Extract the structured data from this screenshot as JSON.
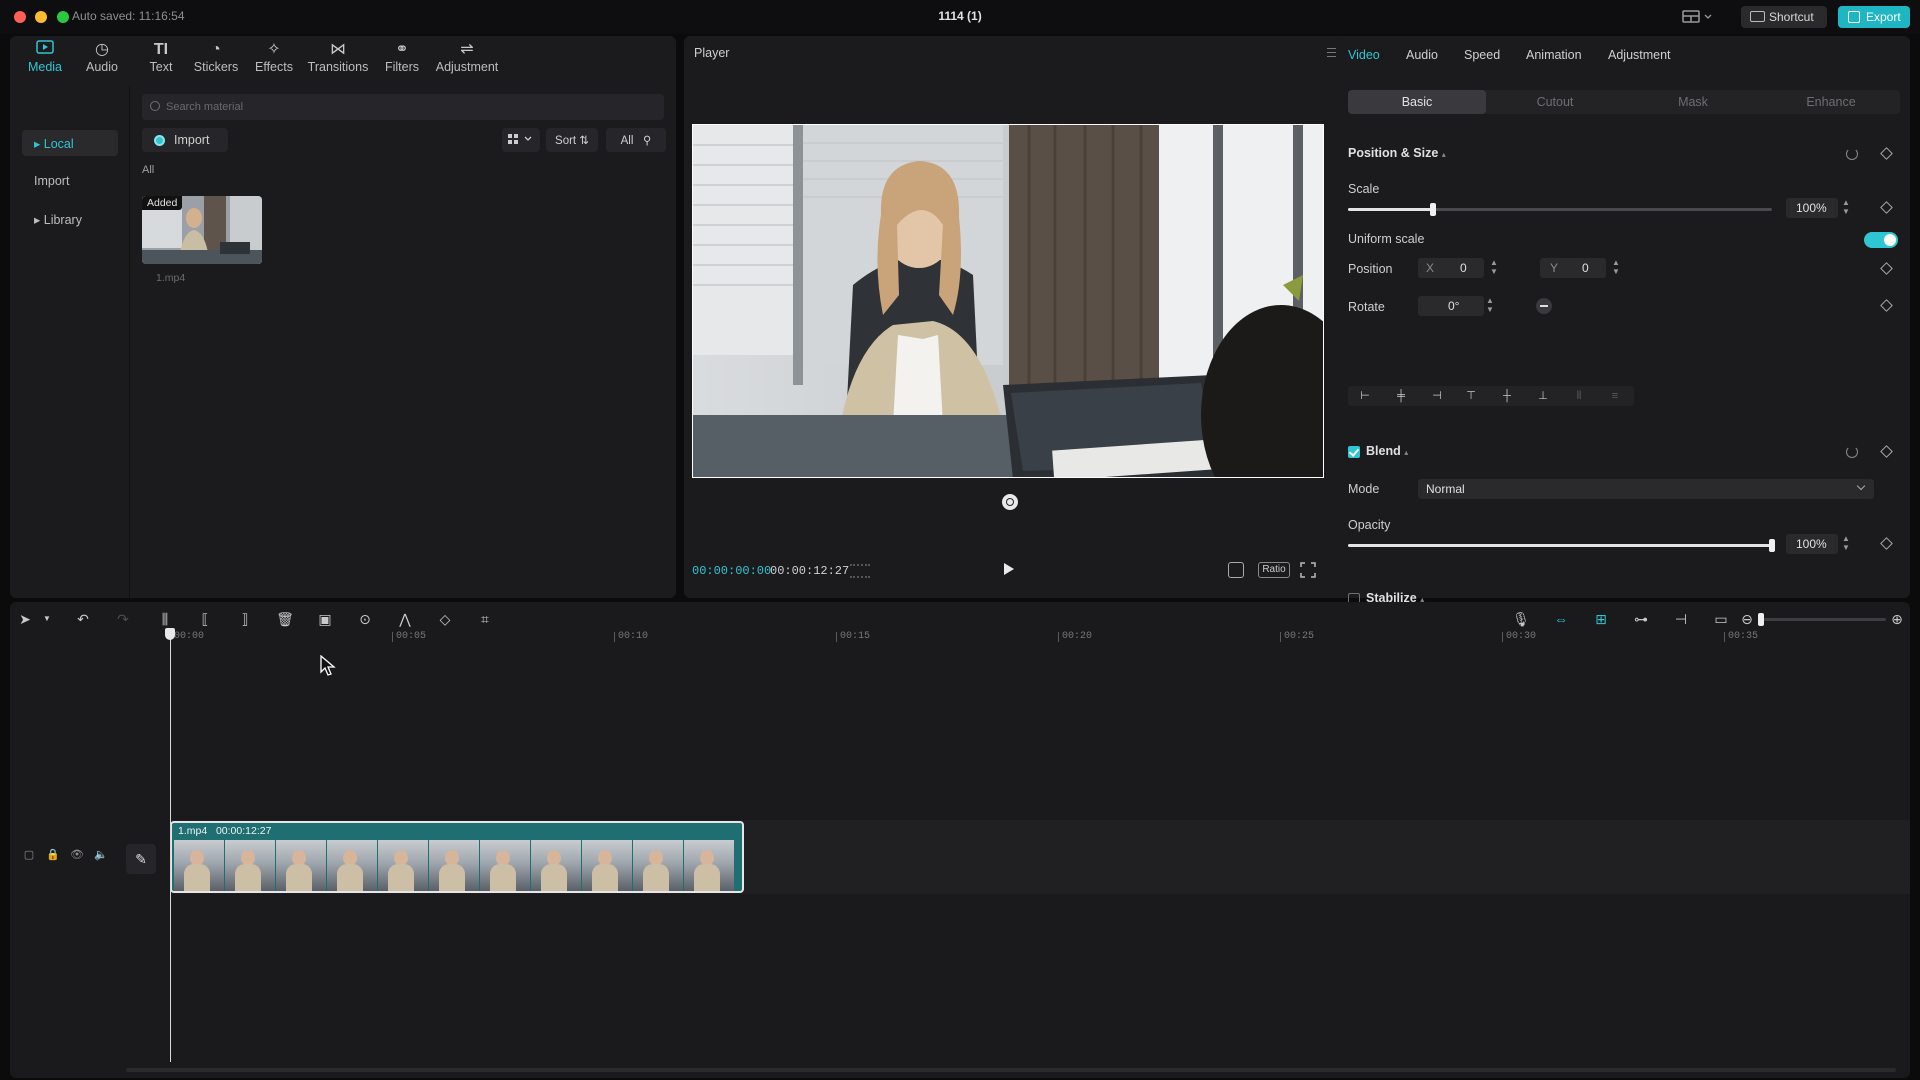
{
  "titlebar": {
    "autosave": "Auto saved: 11:16:54",
    "title": "1114 (1)",
    "shortcut_label": "Shortcut",
    "export_label": "Export"
  },
  "media": {
    "tabs": [
      {
        "label": "Media",
        "icon": "media-icon",
        "glyph": "▶"
      },
      {
        "label": "Audio",
        "icon": "audio-icon",
        "glyph": "◷"
      },
      {
        "label": "Text",
        "icon": "text-icon",
        "glyph": "TI"
      },
      {
        "label": "Stickers",
        "icon": "stickers-icon",
        "glyph": "◔"
      },
      {
        "label": "Effects",
        "icon": "effects-icon",
        "glyph": "✧"
      },
      {
        "label": "Transitions",
        "icon": "transitions-icon",
        "glyph": "⋈"
      },
      {
        "label": "Filters",
        "icon": "filters-icon",
        "glyph": "⚭"
      },
      {
        "label": "Adjustment",
        "icon": "adjustment-icon",
        "glyph": "⇌"
      }
    ],
    "sidebar": {
      "local": "▸ Local",
      "import": "Import",
      "library": "▸ Library"
    },
    "search_placeholder": "Search material",
    "import_label": "Import",
    "sort_label": "Sort",
    "all_chip": "All",
    "filter_all": "All",
    "thumb_badge": "Added",
    "thumb_name": "1.mp4"
  },
  "player": {
    "title": "Player",
    "current_time": "00:00:00:00",
    "duration": "00:00:12:27",
    "ratio_label": "Ratio"
  },
  "properties": {
    "tabs": [
      "Video",
      "Audio",
      "Speed",
      "Animation",
      "Adjustment"
    ],
    "subtabs": [
      "Basic",
      "Cutout",
      "Mask",
      "Enhance"
    ],
    "position_size": "Position & Size",
    "scale_label": "Scale",
    "scale_value": "100%",
    "scale_fraction": 0.2,
    "uniform_scale": "Uniform scale",
    "position_label": "Position",
    "x_label": "X",
    "x_value": "0",
    "y_label": "Y",
    "y_value": "0",
    "rotate_label": "Rotate",
    "rotate_value": "0°",
    "blend_label": "Blend",
    "mode_label": "Mode",
    "mode_value": "Normal",
    "opacity_label": "Opacity",
    "opacity_value": "100%",
    "opacity_fraction": 1.0,
    "stabilize_label": "Stabilize"
  },
  "timeline": {
    "ruler": [
      "00:00",
      "00:05",
      "00:10",
      "00:15",
      "00:20",
      "00:25",
      "00:30",
      "00:35"
    ],
    "clip_name": "1.mp4",
    "clip_duration": "00:00:12:27"
  },
  "colors": {
    "accent": "#2fc5d3",
    "export": "#1fb6c4",
    "panel": "#1b1b1d"
  }
}
